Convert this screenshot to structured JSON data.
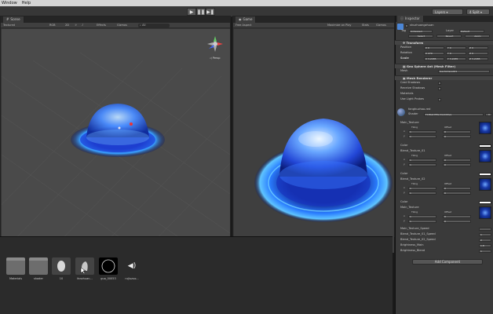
{
  "menu": {
    "items": [
      "Window",
      "Help"
    ]
  },
  "toolbar": {
    "play_icon": "play-icon",
    "pause_icon": "pause-icon",
    "step_icon": "step-icon",
    "layers_label": "Layers",
    "layout_label": "4 Split"
  },
  "scene": {
    "tab_label": "Scene",
    "shading_mode": "Textured",
    "render_mode": "RGB",
    "toggle_2d": "2D",
    "effects_label": "Effects",
    "gizmos_label": "Gizmos",
    "search_placeholder": "All",
    "persp_label": "Persp"
  },
  "game": {
    "tab_label": "Game",
    "aspect_label": "Free Aspect",
    "maximize_label": "Maximize on Play",
    "stats_label": "Stats",
    "gizmos_label": "Gizmos"
  },
  "project": {
    "assets": [
      {
        "label": "Materials",
        "kind": "folder"
      },
      {
        "label": "shader",
        "kind": "folder"
      },
      {
        "label": "10",
        "kind": "mesh"
      },
      {
        "label": "fanzhuan...",
        "kind": "mesh"
      },
      {
        "label": "guo_00053",
        "kind": "texture"
      },
      {
        "label": "rujiuzuo...",
        "kind": "audio"
      }
    ]
  },
  "inspector": {
    "tab_label": "Inspector",
    "object_name": "shuzhuangzhuan",
    "tag_label": "Tag",
    "tag_value": "Untagged",
    "layer_label": "Layer",
    "layer_value": "Default",
    "prefab_select": "Select",
    "prefab_revert": "Revert",
    "prefab_apply": "Apply",
    "transform": {
      "header": "Transform",
      "position_label": "Position",
      "rotation_label": "Rotation",
      "scale_label": "Scale",
      "position": [
        "X 0",
        "Y 0",
        "Z 0"
      ],
      "rotation": [
        "X 270",
        "Y 0",
        "Z 0"
      ],
      "scale": [
        "X 3.2485",
        "Y 3.2485",
        "Z 3.2485"
      ]
    },
    "mesh_filter": {
      "header": "Geo Sphere 4nt (Mesh Filter)",
      "mesh_label": "Mesh",
      "mesh_value": "GeoSphere001"
    },
    "mesh_renderer": {
      "header": "Mesh Renderer",
      "cast_shadows": "Cast Shadows",
      "receive_shadows": "Receive Shadows",
      "materials": "Materials",
      "use_light_probes": "Use Light Probes"
    },
    "material": {
      "name": "fanghuzhao-red",
      "shader_label": "Shader",
      "shader_value": "FX/Ball Effect/Additive"
    },
    "properties": [
      {
        "name": "Main_Texture"
      },
      {
        "name": "Blend_Texture_01"
      },
      {
        "name": "Blend_Texture_02"
      },
      {
        "name": "Main_Texture"
      }
    ],
    "tiling_label": "Tiling",
    "offset_label": "Offset",
    "color_label": "Color",
    "axis_x": "x",
    "axis_y": "y",
    "val_one": "1",
    "val_zero": "0",
    "speeds": [
      {
        "name": "Main_Texture_Speed",
        "value": ""
      },
      {
        "name": "Blend_Texture_01_Speed",
        "value": "1"
      },
      {
        "name": "Blend_Texture_02_Speed",
        "value": "2"
      },
      {
        "name": "Brightness_Main",
        "value": "1.8"
      },
      {
        "name": "Brightness_Blend",
        "value": "1"
      }
    ],
    "add_component": "Add Component"
  }
}
